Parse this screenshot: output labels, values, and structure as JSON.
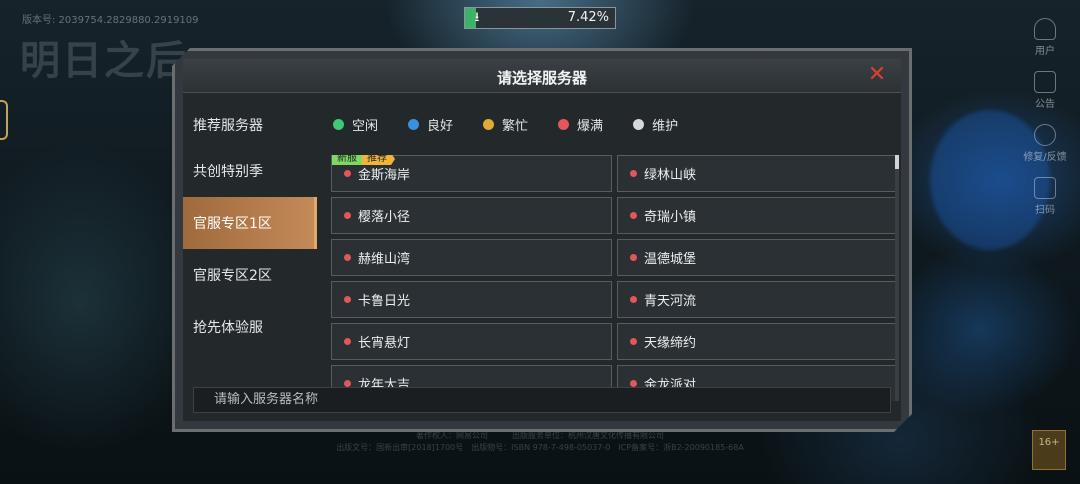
{
  "version": "版本号: 2039754.2829880.2919109",
  "logo_text": "明日之后",
  "download": {
    "percent_text": "7.42%",
    "progress": 0.0742,
    "icon": "download-arrow-icon"
  },
  "side_icons": [
    {
      "name": "user-icon",
      "label": "用户"
    },
    {
      "name": "notice-icon",
      "label": "公告"
    },
    {
      "name": "repair-icon",
      "label": "修复/反馈"
    },
    {
      "name": "scan-icon",
      "label": "扫码"
    }
  ],
  "dialog": {
    "title": "请选择服务器",
    "close_icon": "close-icon",
    "status_label": "推荐服务器",
    "legend": [
      {
        "label": "空闲",
        "color": "#3ec878"
      },
      {
        "label": "良好",
        "color": "#3b8fe0"
      },
      {
        "label": "繁忙",
        "color": "#e3a938"
      },
      {
        "label": "爆满",
        "color": "#e3565a"
      },
      {
        "label": "维护",
        "color": "#d6d8da"
      }
    ],
    "tabs": [
      {
        "label": "共创特别季",
        "active": false
      },
      {
        "label": "官服专区1区",
        "active": true
      },
      {
        "label": "官服专区2区",
        "active": false
      },
      {
        "label": "抢先体验服",
        "active": false
      }
    ],
    "first_tags": {
      "new": "新服",
      "recommended": "推荐"
    },
    "servers": [
      {
        "name": "金斯海岸",
        "status_color": "#e3565a"
      },
      {
        "name": "绿林山峡",
        "status_color": "#e3565a"
      },
      {
        "name": "樱落小径",
        "status_color": "#e3565a"
      },
      {
        "name": "奇瑞小镇",
        "status_color": "#e3565a"
      },
      {
        "name": "赫维山湾",
        "status_color": "#e3565a"
      },
      {
        "name": "温德城堡",
        "status_color": "#e3565a"
      },
      {
        "name": "卡鲁日光",
        "status_color": "#e3565a"
      },
      {
        "name": "青天河流",
        "status_color": "#e3565a"
      },
      {
        "name": "长宵悬灯",
        "status_color": "#e3565a"
      },
      {
        "name": "天缘缔约",
        "status_color": "#e3565a"
      },
      {
        "name": "龙年大吉",
        "status_color": "#e3565a"
      },
      {
        "name": "金龙派对",
        "status_color": "#e3565a"
      }
    ],
    "search_placeholder": "请输入服务器名称"
  },
  "footer": {
    "line1": "著作权人：网易公司　　　出版服务单位：杭州汉唐文化传播有限公司",
    "line2": "出版文号：国新出审[2018]1700号　出版物号：ISBN 978-7-498-05037-0　ICP备案号：浙B2-20090185-68A"
  },
  "age_badge": "16+"
}
